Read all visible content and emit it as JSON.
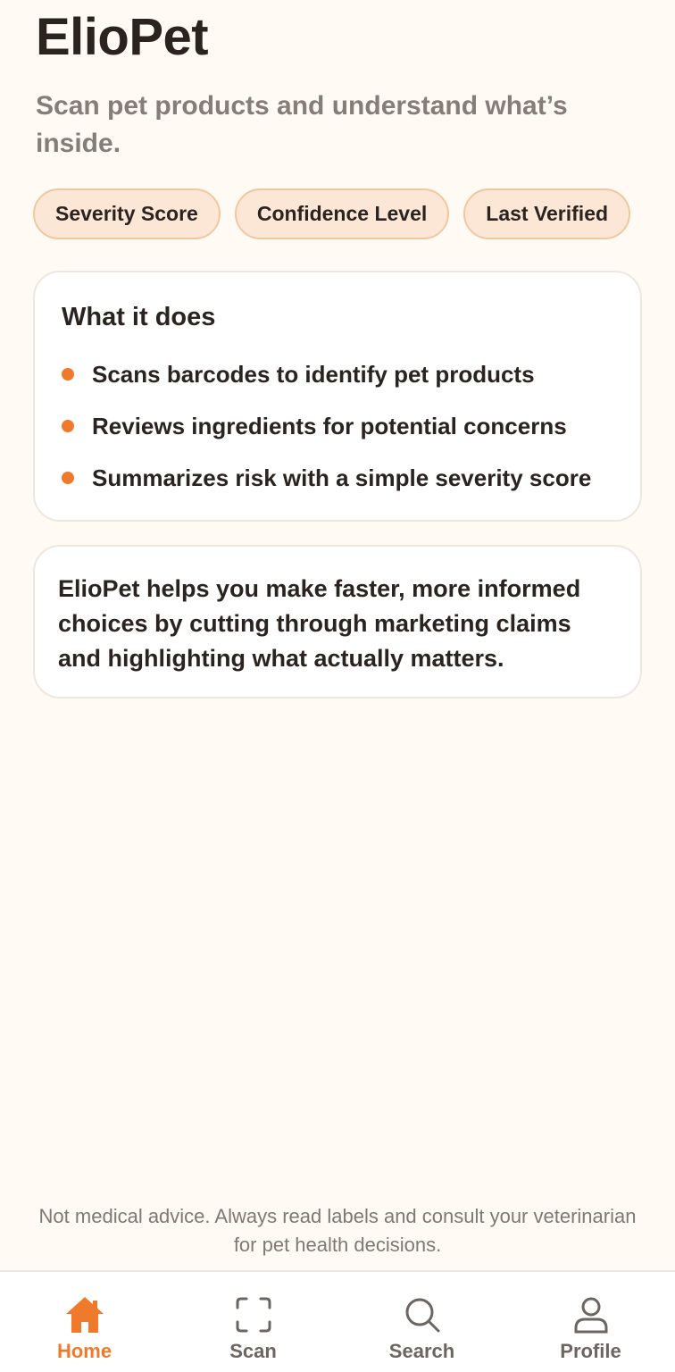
{
  "header": {
    "title": "ElioPet",
    "subtitle": "Scan pet products and understand what’s inside."
  },
  "chips": [
    {
      "label": "Severity Score"
    },
    {
      "label": "Confidence Level"
    },
    {
      "label": "Last Verified"
    }
  ],
  "what_it_does": {
    "heading": "What it does",
    "items": [
      "Scans barcodes to identify pet products",
      "Reviews ingredients for potential concerns",
      "Summarizes risk with a simple severity score"
    ]
  },
  "about": {
    "text": "ElioPet helps you make faster, more informed choices by cutting through marketing claims and highlighting what actually matters."
  },
  "disclaimer": "Not medical advice. Always read labels and consult your veterinarian for pet health decisions.",
  "tabbar": {
    "active": "home",
    "tabs": [
      {
        "id": "home",
        "label": "Home",
        "icon": "home-icon"
      },
      {
        "id": "scan",
        "label": "Scan",
        "icon": "scan-icon"
      },
      {
        "id": "search",
        "label": "Search",
        "icon": "search-icon"
      },
      {
        "id": "profile",
        "label": "Profile",
        "icon": "profile-icon"
      }
    ]
  },
  "colors": {
    "accent": "#f07a2b",
    "background": "#fffaf3",
    "chip_fill": "#fce6d6",
    "text": "#2b2320",
    "muted": "#857d78"
  }
}
